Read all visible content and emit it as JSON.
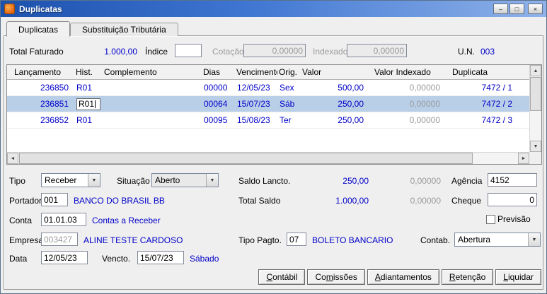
{
  "window": {
    "title": "Duplicatas"
  },
  "titlebar": {
    "minimize_glyph": "–",
    "restore_glyph": "□",
    "close_glyph": "×"
  },
  "tabs": [
    {
      "label": "Duplicatas"
    },
    {
      "label": "Substituição Tributária"
    }
  ],
  "summary": {
    "total_faturado_label": "Total Faturado",
    "total_faturado_value": "1.000,00",
    "indice_label": "Índice",
    "indice_value": "",
    "cotacao_label": "Cotação",
    "cotacao_value": "0,00000",
    "indexado_label": "Indexado",
    "indexado_value": "0,00000",
    "un_label": "U.N.",
    "un_value": "003"
  },
  "grid": {
    "columns": [
      "Lançamento",
      "Hist.",
      "Complemento",
      "Dias",
      "Vencimento",
      "Orig.",
      "Valor",
      "Valor Indexado",
      "Duplicata"
    ],
    "rows": [
      {
        "lancamento": "236850",
        "hist": "R01",
        "complemento": "",
        "dias": "00000",
        "vencimento": "12/05/23",
        "orig": "Sex",
        "valor": "500,00",
        "valor_indexado": "0,00000",
        "duplicata": "7472 / 1"
      },
      {
        "lancamento": "236851",
        "hist": "R01",
        "complemento": "",
        "dias": "00064",
        "vencimento": "15/07/23",
        "orig": "Sáb",
        "valor": "250,00",
        "valor_indexado": "0,00000",
        "duplicata": "7472 / 2"
      },
      {
        "lancamento": "236852",
        "hist": "R01",
        "complemento": "",
        "dias": "00095",
        "vencimento": "15/08/23",
        "orig": "Ter",
        "valor": "250,00",
        "valor_indexado": "0,00000",
        "duplicata": "7472 / 3"
      }
    ]
  },
  "form": {
    "tipo_label": "Tipo",
    "tipo_value": "Receber",
    "situacao_label": "Situação",
    "situacao_value": "Aberto",
    "saldo_lancto_label": "Saldo Lancto.",
    "saldo_lancto_value": "250,00",
    "saldo_lancto_indexado": "0,00000",
    "agencia_label": "Agência",
    "agencia_value": "4152",
    "portador_label": "Portador",
    "portador_code": "001",
    "portador_name": "BANCO DO BRASIL BB",
    "total_saldo_label": "Total Saldo",
    "total_saldo_value": "1.000,00",
    "total_saldo_indexado": "0,00000",
    "cheque_label": "Cheque",
    "cheque_value": "0",
    "conta_label": "Conta",
    "conta_code": "01.01.03",
    "conta_name": "Contas a Receber",
    "previsao_label": "Previsão",
    "empresa_label": "Empresa",
    "empresa_code": "003427",
    "empresa_name": "ALINE TESTE CARDOSO",
    "tipo_pagto_label": "Tipo Pagto.",
    "tipo_pagto_code": "07",
    "tipo_pagto_name": "BOLETO BANCARIO",
    "contab_label": "Contab.",
    "contab_value": "Abertura",
    "data_label": "Data",
    "data_value": "12/05/23",
    "vencto_label": "Vencto.",
    "vencto_value": "15/07/23",
    "vencto_weekday": "Sábado"
  },
  "buttons": [
    {
      "pre": "",
      "key": "C",
      "post": "ontábil"
    },
    {
      "pre": "Co",
      "key": "m",
      "post": "issões"
    },
    {
      "pre": "",
      "key": "A",
      "post": "diantamentos"
    },
    {
      "pre": "",
      "key": "R",
      "post": "etenção"
    },
    {
      "pre": "",
      "key": "L",
      "post": "iquidar"
    }
  ],
  "icons": {
    "combo_arrow": "▼",
    "scroll_up": "▲",
    "scroll_down": "▼",
    "scroll_left": "◄",
    "scroll_right": "►"
  },
  "colors": {
    "data_blue": "#0000c8",
    "disabled_gray": "#9b9b9b",
    "selected_row": "#b9cfe8"
  }
}
